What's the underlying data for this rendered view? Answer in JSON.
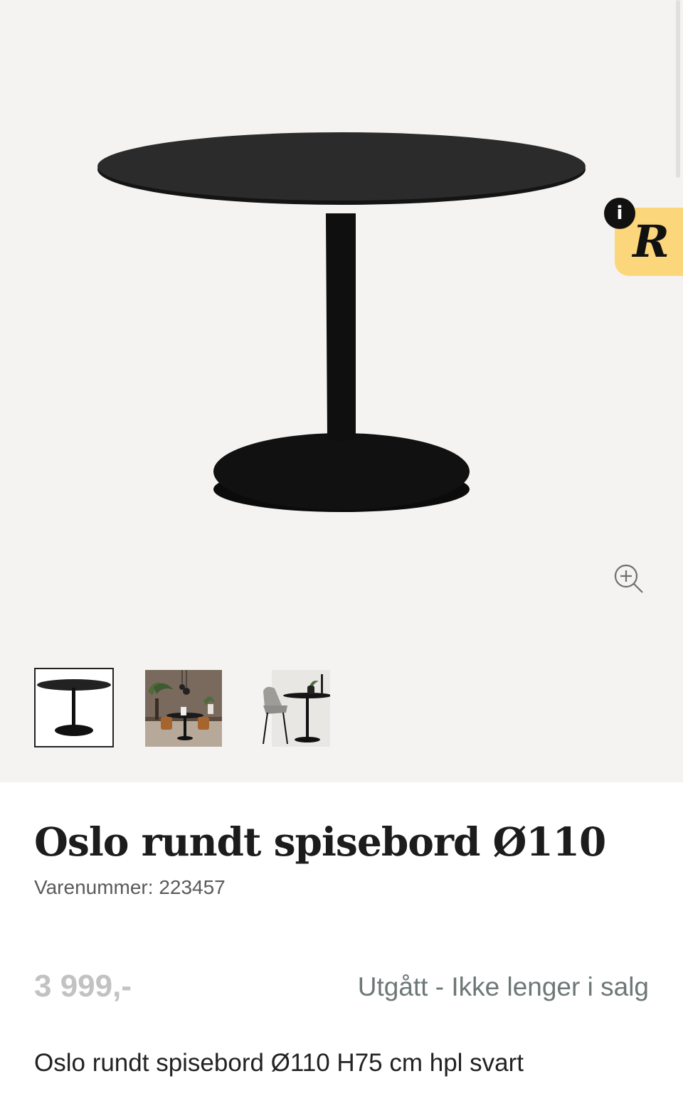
{
  "product": {
    "title": "Oslo rundt spisebord Ø110",
    "sku_label": "Varenummer: 223457",
    "price": "3 999,-",
    "status": "Utgått - Ikke lenger i salg",
    "description": "Oslo rundt spisebord Ø110 H75 cm hpl svart"
  },
  "gallery": {
    "badge_letter": "R",
    "info_icon": "i",
    "zoom_icon": "zoom-in-icon",
    "thumbnails": [
      "table-product-photo",
      "dining-room-scene",
      "table-with-chair-scene"
    ]
  },
  "colors": {
    "gallery_bg": "#f5f3f1",
    "badge_bg": "#fbd67b",
    "price": "#c2c2c2",
    "status": "#6e7777"
  }
}
